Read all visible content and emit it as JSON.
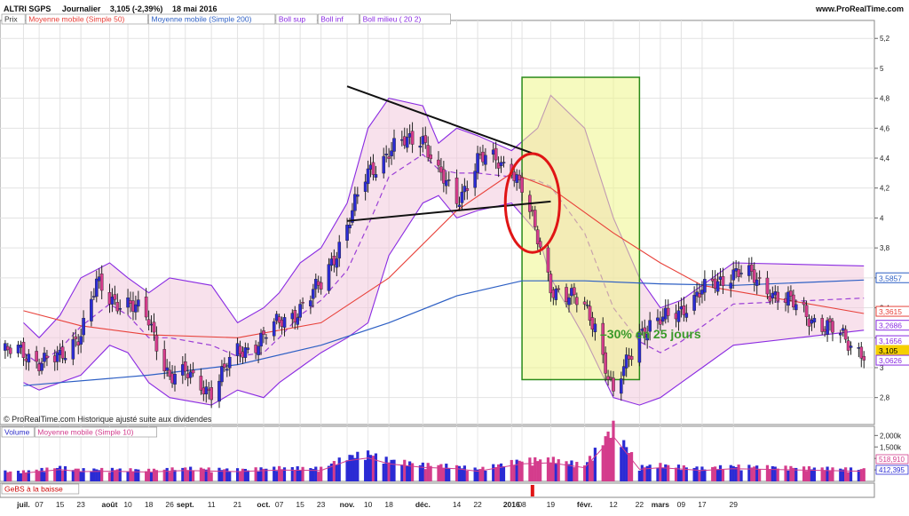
{
  "header": {
    "symbol": "ALTRI SGPS",
    "period": "Journalier",
    "last": "3,105 (-2,39%)",
    "date": "18 mai 2016",
    "site": "www.ProRealTime.com"
  },
  "price_legend": [
    {
      "text": "Prix",
      "color": "#333333"
    },
    {
      "text": "Moyenne mobile (Simple 50)",
      "color": "#e8413a"
    },
    {
      "text": "Moyenne mobile (Simple 200)",
      "color": "#2d5fc4"
    },
    {
      "text": "Boll sup",
      "color": "#8a2be2"
    },
    {
      "text": "Boll inf",
      "color": "#8a2be2"
    },
    {
      "text": "Boll milieu ( 20 2)",
      "color": "#8a2be2"
    }
  ],
  "volume_legend": [
    {
      "text": "Volume",
      "color": "#2d2dc8"
    },
    {
      "text": "Moyenne mobile (Simple 10)",
      "color": "#d23c8c"
    }
  ],
  "indicator_legend": {
    "text": "GeBS à la baisse",
    "color": "#cc0000"
  },
  "copyright": "© ProRealTime.com  Historique ajusté suite aux dividendes",
  "annotation": "–30% en 25 jours",
  "chart_data": {
    "type": "candlestick",
    "title": "ALTRI SGPS Journalier",
    "ylim": [
      2.62,
      5.32
    ],
    "y_ticks": [
      "5,2",
      "5",
      "4,8",
      "4,6",
      "4,4",
      "4,2",
      "4",
      "3,8",
      "3,6",
      "3,4",
      "3,2",
      "3",
      "2,8"
    ],
    "y_tick_values": [
      5.2,
      5.0,
      4.8,
      4.6,
      4.4,
      4.2,
      4.0,
      3.8,
      3.6,
      3.4,
      3.2,
      3.0,
      2.8
    ],
    "x_ticks": [
      "juil.",
      "07",
      "15",
      "23",
      "août",
      "10",
      "18",
      "26",
      "sept.",
      "11",
      "21",
      "oct.",
      "07",
      "15",
      "23",
      "nov.",
      "10",
      "18",
      "déc.",
      "14",
      "22",
      "2016",
      "08",
      "19",
      "févr.",
      "12",
      "22",
      "mars",
      "09",
      "17",
      "29"
    ],
    "x_tick_dates": [
      "2015-07-01",
      "2015-07-07",
      "2015-07-15",
      "2015-07-23",
      "2015-08-03",
      "2015-08-10",
      "2015-08-18",
      "2015-08-26",
      "2015-09-01",
      "2015-09-11",
      "2015-09-21",
      "2015-10-01",
      "2015-10-07",
      "2015-10-15",
      "2015-10-23",
      "2015-11-02",
      "2015-11-10",
      "2015-11-18",
      "2015-12-01",
      "2015-12-14",
      "2015-12-22",
      "2016-01-04",
      "2016-01-08",
      "2016-01-19",
      "2016-02-01",
      "2016-02-12",
      "2016-02-22",
      "2016-03-01",
      "2016-03-09",
      "2016-03-17",
      "2016-03-29"
    ],
    "right_labels": [
      {
        "text": "3,5857",
        "value": 3.5857,
        "series": "Moyenne mobile (Simple 200)",
        "color": "#2d5fc4"
      },
      {
        "text": "3,3615",
        "value": 3.3615,
        "series": "Moyenne mobile (Simple 50)",
        "color": "#e8413a"
      },
      {
        "text": "3,2686",
        "value": 3.2686,
        "series": "Boll inf",
        "color": "#8a2be2"
      },
      {
        "text": "3,1656",
        "value": 3.1656,
        "series": "Boll milieu ( 20 2)",
        "color": "#8a2be2"
      },
      {
        "text": "3,105",
        "value": 3.105,
        "series": "Prix",
        "color": "#f5d000"
      },
      {
        "text": "3,0626",
        "value": 3.0626,
        "series": "Boll sup",
        "color": "#8a2be2"
      }
    ],
    "close_points": [
      [
        "2015-07-01",
        3.1
      ],
      [
        "2015-07-07",
        3.05
      ],
      [
        "2015-07-15",
        3.05
      ],
      [
        "2015-07-23",
        3.25
      ],
      [
        "2015-07-29",
        3.55
      ],
      [
        "2015-08-03",
        3.45
      ],
      [
        "2015-08-10",
        3.45
      ],
      [
        "2015-08-18",
        3.3
      ],
      [
        "2015-08-26",
        2.95
      ],
      [
        "2015-09-01",
        2.95
      ],
      [
        "2015-09-11",
        2.85
      ],
      [
        "2015-09-21",
        3.1
      ],
      [
        "2015-10-01",
        3.2
      ],
      [
        "2015-10-07",
        3.3
      ],
      [
        "2015-10-15",
        3.4
      ],
      [
        "2015-10-23",
        3.55
      ],
      [
        "2015-11-02",
        3.95
      ],
      [
        "2015-11-10",
        4.3
      ],
      [
        "2015-11-18",
        4.45
      ],
      [
        "2015-12-01",
        4.55
      ],
      [
        "2015-12-07",
        4.3
      ],
      [
        "2015-12-14",
        4.1
      ],
      [
        "2015-12-22",
        4.4
      ],
      [
        "2016-01-04",
        4.35
      ],
      [
        "2016-01-08",
        4.2
      ],
      [
        "2016-01-14",
        3.85
      ],
      [
        "2016-01-19",
        3.55
      ],
      [
        "2016-02-01",
        3.4
      ],
      [
        "2016-02-05",
        3.3
      ],
      [
        "2016-02-12",
        2.8
      ],
      [
        "2016-02-22",
        3.25
      ],
      [
        "2016-03-01",
        3.3
      ],
      [
        "2016-03-09",
        3.4
      ],
      [
        "2016-03-17",
        3.5
      ],
      [
        "2016-03-29",
        3.65
      ],
      [
        "2016-04-05",
        3.6
      ],
      [
        "2016-05-18",
        3.105
      ]
    ],
    "sma50_points": [
      [
        "2015-07-01",
        3.38
      ],
      [
        "2015-07-23",
        3.28
      ],
      [
        "2015-08-18",
        3.22
      ],
      [
        "2015-09-21",
        3.2
      ],
      [
        "2015-10-23",
        3.3
      ],
      [
        "2015-11-18",
        3.6
      ],
      [
        "2015-12-14",
        4.05
      ],
      [
        "2016-01-04",
        4.3
      ],
      [
        "2016-01-19",
        4.2
      ],
      [
        "2016-02-12",
        3.9
      ],
      [
        "2016-03-01",
        3.7
      ],
      [
        "2016-03-17",
        3.55
      ],
      [
        "2016-05-18",
        3.3615
      ]
    ],
    "sma200_points": [
      [
        "2015-07-01",
        2.88
      ],
      [
        "2015-08-18",
        2.95
      ],
      [
        "2015-09-21",
        3.02
      ],
      [
        "2015-10-23",
        3.15
      ],
      [
        "2015-11-18",
        3.3
      ],
      [
        "2015-12-14",
        3.48
      ],
      [
        "2016-01-08",
        3.58
      ],
      [
        "2016-02-01",
        3.58
      ],
      [
        "2016-03-01",
        3.56
      ],
      [
        "2016-03-29",
        3.55
      ],
      [
        "2016-05-18",
        3.5857
      ]
    ],
    "boll_sup_points": [
      [
        "2015-07-01",
        3.3
      ],
      [
        "2015-07-07",
        3.2
      ],
      [
        "2015-07-15",
        3.35
      ],
      [
        "2015-07-23",
        3.6
      ],
      [
        "2015-08-03",
        3.7
      ],
      [
        "2015-08-10",
        3.6
      ],
      [
        "2015-08-18",
        3.5
      ],
      [
        "2015-08-26",
        3.6
      ],
      [
        "2015-09-11",
        3.55
      ],
      [
        "2015-09-21",
        3.3
      ],
      [
        "2015-10-01",
        3.4
      ],
      [
        "2015-10-07",
        3.5
      ],
      [
        "2015-10-15",
        3.7
      ],
      [
        "2015-10-23",
        3.8
      ],
      [
        "2015-11-02",
        4.1
      ],
      [
        "2015-11-10",
        4.6
      ],
      [
        "2015-11-18",
        4.8
      ],
      [
        "2015-12-01",
        4.75
      ],
      [
        "2015-12-07",
        4.5
      ],
      [
        "2015-12-14",
        4.6
      ],
      [
        "2015-12-22",
        4.55
      ],
      [
        "2016-01-04",
        4.45
      ],
      [
        "2016-01-14",
        4.6
      ],
      [
        "2016-01-19",
        4.82
      ],
      [
        "2016-02-01",
        4.6
      ],
      [
        "2016-02-12",
        4.0
      ],
      [
        "2016-02-22",
        3.6
      ],
      [
        "2016-03-01",
        3.4
      ],
      [
        "2016-03-09",
        3.45
      ],
      [
        "2016-03-17",
        3.55
      ],
      [
        "2016-03-29",
        3.7
      ],
      [
        "2016-05-18",
        3.68
      ]
    ],
    "boll_inf_points": [
      [
        "2015-07-01",
        2.9
      ],
      [
        "2015-07-07",
        2.85
      ],
      [
        "2015-07-15",
        2.9
      ],
      [
        "2015-07-23",
        2.95
      ],
      [
        "2015-08-03",
        3.15
      ],
      [
        "2015-08-10",
        3.1
      ],
      [
        "2015-08-18",
        2.9
      ],
      [
        "2015-08-26",
        2.8
      ],
      [
        "2015-09-11",
        2.75
      ],
      [
        "2015-09-21",
        2.85
      ],
      [
        "2015-10-01",
        2.8
      ],
      [
        "2015-10-07",
        2.9
      ],
      [
        "2015-10-15",
        3.0
      ],
      [
        "2015-10-23",
        3.1
      ],
      [
        "2015-11-02",
        3.2
      ],
      [
        "2015-11-10",
        3.3
      ],
      [
        "2015-11-18",
        3.75
      ],
      [
        "2015-12-01",
        4.1
      ],
      [
        "2015-12-07",
        4.15
      ],
      [
        "2015-12-14",
        4.0
      ],
      [
        "2015-12-22",
        4.05
      ],
      [
        "2016-01-04",
        4.1
      ],
      [
        "2016-01-14",
        3.9
      ],
      [
        "2016-01-19",
        3.6
      ],
      [
        "2016-02-01",
        3.2
      ],
      [
        "2016-02-12",
        2.8
      ],
      [
        "2016-02-22",
        2.75
      ],
      [
        "2016-03-01",
        2.8
      ],
      [
        "2016-03-09",
        2.9
      ],
      [
        "2016-03-17",
        3.0
      ],
      [
        "2016-03-29",
        3.15
      ],
      [
        "2016-05-18",
        3.25
      ]
    ],
    "volume_ylim": [
      0,
      2400000
    ],
    "volume_ticks": [
      "2,000k",
      "1,500k",
      "1,000k",
      "500k"
    ],
    "volume_tick_values": [
      2000000,
      1500000,
      1000000,
      500000
    ],
    "volume_right_labels": [
      "518,910",
      "412,395"
    ],
    "volume_points": [
      [
        "2015-07-01",
        420000
      ],
      [
        "2015-07-15",
        600000
      ],
      [
        "2015-07-23",
        500000
      ],
      [
        "2015-08-03",
        520000
      ],
      [
        "2015-08-18",
        480000
      ],
      [
        "2015-09-01",
        560000
      ],
      [
        "2015-09-21",
        500000
      ],
      [
        "2015-10-07",
        580000
      ],
      [
        "2015-10-23",
        560000
      ],
      [
        "2015-11-02",
        1050000
      ],
      [
        "2015-11-10",
        1200000
      ],
      [
        "2015-11-18",
        900000
      ],
      [
        "2015-12-01",
        720000
      ],
      [
        "2015-12-14",
        650000
      ],
      [
        "2015-12-22",
        520000
      ],
      [
        "2016-01-08",
        900000
      ],
      [
        "2016-01-19",
        950000
      ],
      [
        "2016-02-01",
        700000
      ],
      [
        "2016-02-12",
        2300000
      ],
      [
        "2016-02-22",
        620000
      ],
      [
        "2016-03-01",
        700000
      ],
      [
        "2016-03-17",
        560000
      ],
      [
        "2016-03-29",
        650000
      ],
      [
        "2016-05-18",
        520000
      ]
    ],
    "signal_dates": [
      "2016-01-12"
    ],
    "trend_lines": [
      {
        "from": [
          "2015-11-02",
          4.88
        ],
        "to": [
          "2016-01-14",
          4.42
        ]
      },
      {
        "from": [
          "2015-11-02",
          3.98
        ],
        "to": [
          "2016-01-19",
          4.11
        ]
      }
    ],
    "highlight": {
      "from": [
        "2016-01-08",
        2.92
      ],
      "to": [
        "2016-02-22",
        4.94
      ]
    },
    "ellipse": {
      "center": [
        "2016-01-12",
        4.1
      ],
      "x_span_days": 4,
      "y_radius": 0.33
    }
  }
}
